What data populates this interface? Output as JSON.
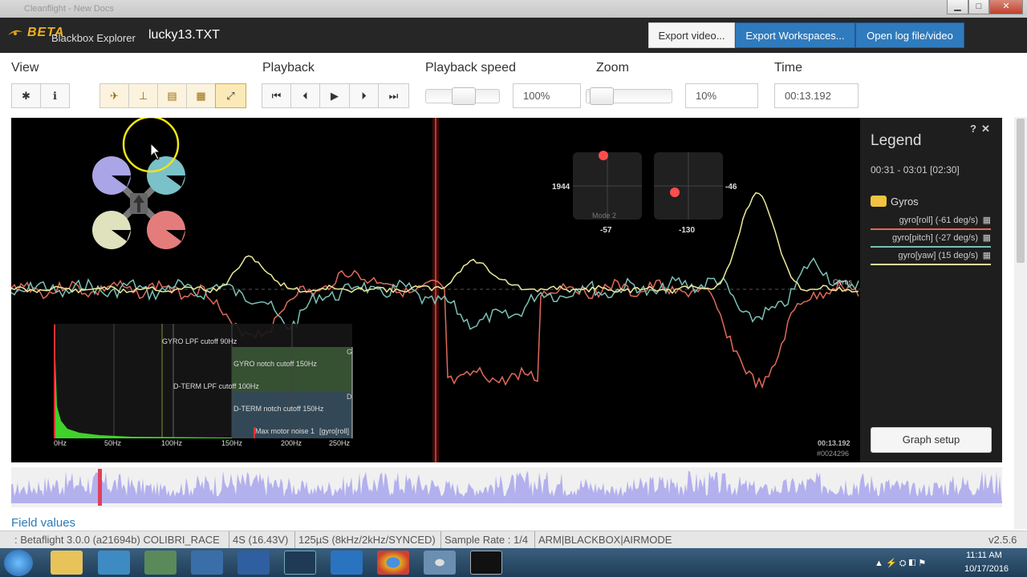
{
  "window": {
    "browser_tab": "Cleanflight - New Docs",
    "min_glyph": "▁",
    "max_glyph": "□",
    "close_glyph": "✕"
  },
  "header": {
    "brand_top": "BETA",
    "brand_sub": "Blackbox Explorer",
    "filename": "lucky13.TXT",
    "buttons": {
      "export_video": "Export video...",
      "export_workspaces": "Export Workspaces...",
      "open_log": "Open log file/video"
    }
  },
  "toolbar": {
    "view_label": "View",
    "playback_label": "Playback",
    "speed_label": "Playback speed",
    "zoom_label": "Zoom",
    "time_label": "Time",
    "speed_value": "100%",
    "zoom_value": "10%",
    "time_value": "00:13.192",
    "speed_fraction": 0.5,
    "zoom_fraction": 0.05,
    "view_icons": [
      "gear-icon",
      "info-icon",
      "craft-icon",
      "sticks-icon",
      "table-icon",
      "analyser-icon",
      "expand-icon"
    ],
    "view_glyphs": [
      "✱",
      "ℹ",
      "✈",
      "⊥",
      "▤",
      "▦",
      "⤢"
    ],
    "playback_icons": [
      "skip-start-icon",
      "step-back-icon",
      "play-icon",
      "step-forward-icon",
      "skip-end-icon"
    ],
    "playback_glyphs": [
      "⏮",
      "⏴",
      "▶",
      "⏵",
      "⏭"
    ]
  },
  "graph": {
    "sticks": {
      "left_side": "1944",
      "left_bottom": "-57",
      "right_side": "-46",
      "right_bottom": "-130",
      "mode": "Mode 2"
    },
    "series_label": "Gyros",
    "time_stamp": "00:13.192",
    "frame_id": "#0024296",
    "analyser": {
      "labels": [
        "GYRO LPF cutoff 90Hz",
        "GYRO notch cutoff 150Hz",
        "D-TERM LPF cutoff 100Hz",
        "D-TERM notch cutoff 150Hz",
        "Max motor noise 1"
      ],
      "edge_g": "G",
      "edge_d": "D",
      "field_tag": "[gyro[roll]",
      "freq_ticks": [
        "0Hz",
        "50Hz",
        "100Hz",
        "150Hz",
        "200Hz",
        "250Hz"
      ]
    },
    "motor_colors": [
      "#a9a5e6",
      "#7bc1c9",
      "#dfe2bd",
      "#e57c7c"
    ]
  },
  "legend": {
    "title": "Legend",
    "help_icon": "?",
    "close_icon": "✕",
    "time_range": "00:31 - 03:01 [02:30]",
    "group_name": "Gyros",
    "entries": [
      {
        "label": "gyro[roll] (-61 deg/s)",
        "color": "#e06a5a"
      },
      {
        "label": "gyro[pitch] (-27 deg/s)",
        "color": "#7bc1b6"
      },
      {
        "label": "gyro[yaw] (15 deg/s)",
        "color": "#ecea9a"
      }
    ],
    "setup_button": "Graph setup"
  },
  "field_values_label": "Field values",
  "status": {
    "items": [
      ": Betaflight 3.0.0 (a21694b) COLIBRI_RACE",
      "4S (16.43V)",
      "125µS (8kHz/2kHz/SYNCED)",
      "Sample Rate : 1/4",
      "ARM|BLACKBOX|AIRMODE"
    ],
    "version": "v2.5.6"
  },
  "taskbar": {
    "clock_time": "11:11 AM",
    "clock_date": "10/17/2016",
    "apps": [
      "start-button",
      "explorer-icon",
      "network-icon",
      "calc-icon",
      "chart-app-icon",
      "book-icon",
      "scope-icon",
      "outlook-icon",
      "chrome-icon",
      "media-icon",
      "blackbox-icon"
    ]
  }
}
